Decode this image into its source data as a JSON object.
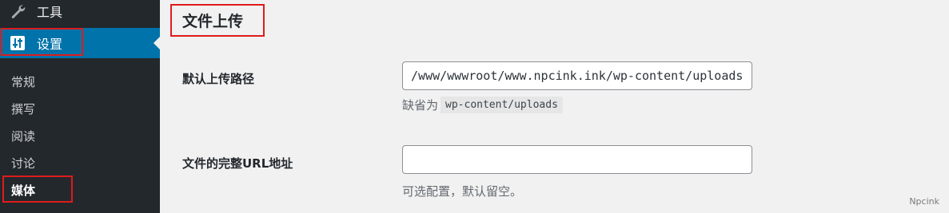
{
  "sidebar": {
    "tools": {
      "label": "工具",
      "icon": "wrench-icon"
    },
    "settings": {
      "label": "设置",
      "icon": "settings-sliders-icon"
    },
    "submenu": [
      {
        "label": "常规"
      },
      {
        "label": "撰写"
      },
      {
        "label": "阅读"
      },
      {
        "label": "讨论"
      },
      {
        "label": "媒体",
        "current": true
      }
    ]
  },
  "main": {
    "section_title": "文件上传",
    "upload_path": {
      "label": "默认上传路径",
      "value": "/www/wwwroot/www.npcink.ink/wp-content/uploads",
      "desc_prefix": "缺省为",
      "desc_code": "wp-content/uploads"
    },
    "upload_url": {
      "label": "文件的完整URL地址",
      "value": "",
      "desc": "可选配置，默认留空。"
    }
  },
  "watermark": "Npcink",
  "colors": {
    "sidebar_bg": "#23282d",
    "active_bg": "#0073aa",
    "highlight_border": "#e01b1b",
    "content_bg": "#f1f1f1"
  }
}
